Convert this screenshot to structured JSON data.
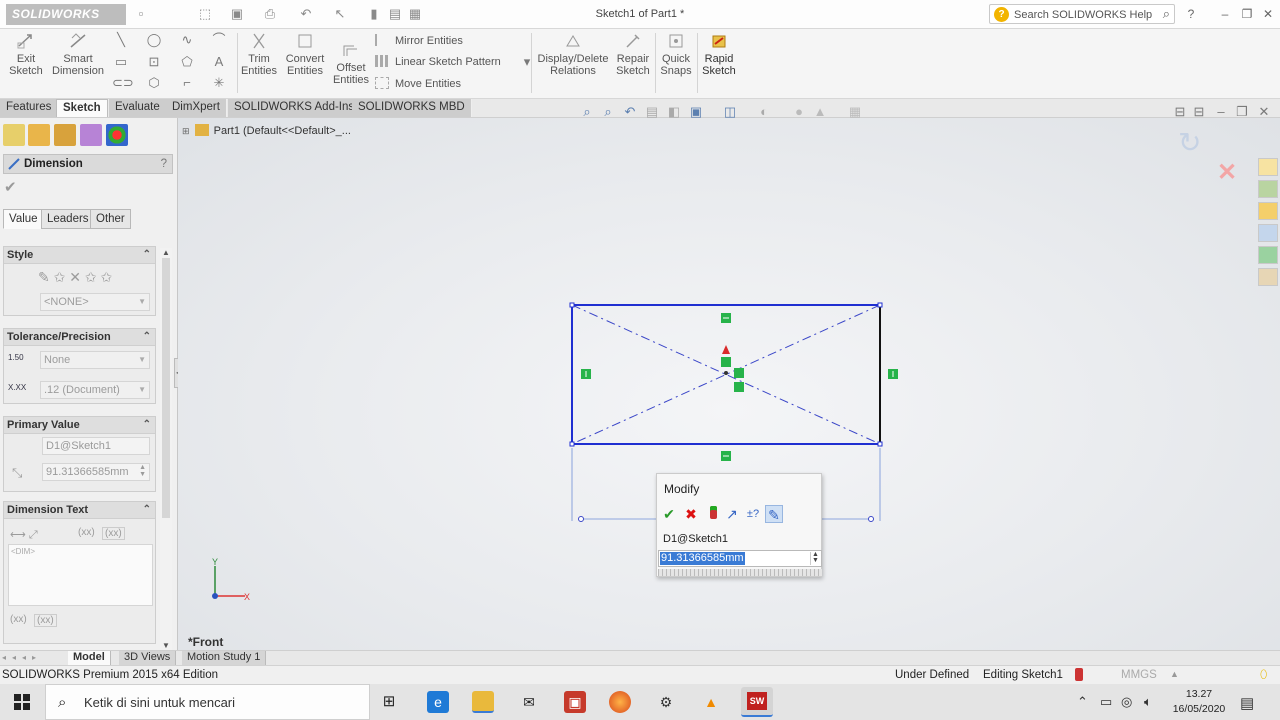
{
  "titlebar": {
    "logo": "SOLIDWORKS",
    "doc_title": "Sketch1 of Part1 *",
    "search_placeholder": "Search SOLIDWORKS Help"
  },
  "ribbon": {
    "exit_sketch": [
      "Exit",
      "Sketch"
    ],
    "smart_dimension": [
      "Smart",
      "Dimension"
    ],
    "trim_entities": [
      "Trim",
      "Entities"
    ],
    "convert_entities": [
      "Convert",
      "Entities"
    ],
    "offset_entities": [
      "Offset",
      "Entities"
    ],
    "mirror_entities": "Mirror Entities",
    "linear_pattern": "Linear Sketch Pattern",
    "move_entities": "Move Entities",
    "display_relations": [
      "Display/Delete",
      "Relations"
    ],
    "repair_sketch": [
      "Repair",
      "Sketch"
    ],
    "quick_snaps": [
      "Quick",
      "Snaps"
    ],
    "rapid_sketch": [
      "Rapid",
      "Sketch"
    ]
  },
  "command_tabs": [
    "Features",
    "Sketch",
    "Evaluate",
    "DimXpert",
    "SOLIDWORKS Add-Ins",
    "SOLIDWORKS MBD"
  ],
  "active_command_tab": "Sketch",
  "property_manager": {
    "title": "Dimension",
    "help": "?",
    "tabs": [
      "Value",
      "Leaders",
      "Other"
    ],
    "style": {
      "header": "Style",
      "dropdown": "<NONE>"
    },
    "tolerance": {
      "header": "Tolerance/Precision",
      "type": "None",
      "precision": ".12 (Document)",
      "tol_icon": "1.50",
      "prec_icon": "X.XX"
    },
    "primary_value": {
      "header": "Primary Value",
      "name": "D1@Sketch1",
      "value": "91.31366585mm"
    },
    "dimension_text": {
      "header": "Dimension Text",
      "placeholder": "<DIM>",
      "xx1": "(xx)",
      "xx2": "(xx)",
      "xx3": "(xx)",
      "xx4": "(xx)"
    }
  },
  "feature_tree": {
    "root": "Part1  (Default<<Default>_..."
  },
  "view_label": "*Front",
  "modify_dialog": {
    "title": "Modify",
    "dimension_name": "D1@Sketch1",
    "value": "91.31366585mm"
  },
  "bottom_tabs": [
    "Model",
    "3D Views",
    "Motion Study 1"
  ],
  "active_bottom_tab": "Model",
  "status": {
    "edition": "SOLIDWORKS Premium 2015 x64 Edition",
    "state": "Under Defined",
    "editing": "Editing Sketch1",
    "units": "MMGS"
  },
  "taskbar": {
    "search_placeholder": "Ketik di sini untuk mencari",
    "time": "13.27",
    "date": "16/05/2020"
  },
  "colors": {
    "sketch_line": "#1f2fd1",
    "construction": "#3a46c8",
    "relation_green": "#27b34a",
    "selection_blue": "#3a7bd5"
  }
}
